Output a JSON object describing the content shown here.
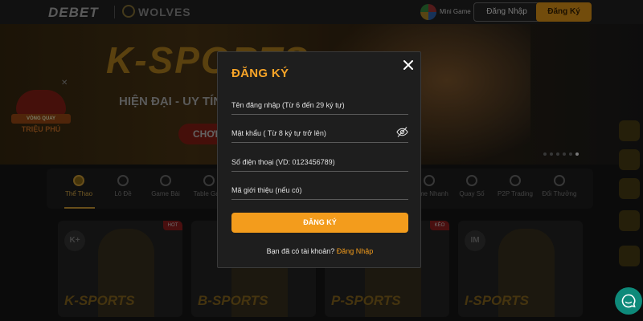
{
  "header": {
    "logo": "DEBET",
    "partner": "WOLVES",
    "mini_game_label": "Mini Game",
    "login_label": "Đăng Nhập",
    "register_label": "Đăng Ký"
  },
  "hero": {
    "title": "K-SPORTS",
    "subtitle": "HIỆN ĐẠI - UY TÍN",
    "cta": "CHƠI"
  },
  "promo": {
    "ribbon": "VÒNG QUAY",
    "label": "TRIỆU PHÚ"
  },
  "categories": [
    {
      "label": "Thể Thao"
    },
    {
      "label": "Lô Đề"
    },
    {
      "label": "Game Bài"
    },
    {
      "label": "Table Ga..."
    },
    {
      "label": "Game Nhanh"
    },
    {
      "label": "Quay Số"
    },
    {
      "label": "P2P Trading"
    },
    {
      "label": "Đổi Thưởng"
    }
  ],
  "cards": [
    {
      "title": "K-SPORTS",
      "badge": "K+",
      "tag": "HOT"
    },
    {
      "title": "B-SPORTS",
      "badge": "B",
      "tag": ""
    },
    {
      "title": "P-SPORTS",
      "badge": "P",
      "tag": "KÈO"
    },
    {
      "title": "I-SPORTS",
      "badge": "IM",
      "tag": ""
    }
  ],
  "modal": {
    "title": "ĐĂNG KÝ",
    "username_placeholder": "Tên đăng nhập (Từ 6 đến 29 ký tự)",
    "password_placeholder": "Mật khẩu ( Từ 8 ký tự trở lên)",
    "phone_placeholder": "Số điện thoại (VD: 0123456789)",
    "referral_placeholder": "Mã giới thiệu (nếu có)",
    "submit_label": "ĐĂNG KÝ",
    "footer_prompt": "Bạn đã có tài khoản?",
    "footer_link": "Đăng Nhập"
  },
  "colors": {
    "accent": "#f39c1c",
    "title": "#f7a428",
    "modal_bg": "#1e1e1e"
  },
  "icons": [
    "close-icon",
    "eye-slash-icon",
    "chat-icon",
    "soccer-ball-icon"
  ]
}
